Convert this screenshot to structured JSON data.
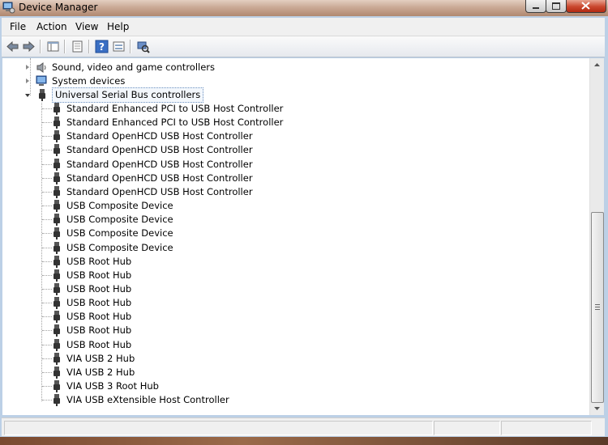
{
  "window": {
    "title": "Device Manager"
  },
  "menu": {
    "items": [
      "File",
      "Action",
      "View",
      "Help"
    ]
  },
  "toolbar": {
    "buttons": [
      "back-arrow-icon",
      "forward-arrow-icon",
      "show-hide-tree-icon",
      "properties-icon",
      "help-icon",
      "view-icon",
      "scan-hardware-icon"
    ]
  },
  "tree": {
    "categories": [
      {
        "label": "Sound, video and game controllers",
        "icon": "speaker-icon",
        "expanded": false
      },
      {
        "label": "System devices",
        "icon": "computer-icon",
        "expanded": false
      },
      {
        "label": "Universal Serial Bus controllers",
        "icon": "usb-plug-icon",
        "expanded": true,
        "selected": true
      }
    ],
    "usb_devices": [
      "Standard Enhanced PCI to USB Host Controller",
      "Standard Enhanced PCI to USB Host Controller",
      "Standard OpenHCD USB Host Controller",
      "Standard OpenHCD USB Host Controller",
      "Standard OpenHCD USB Host Controller",
      "Standard OpenHCD USB Host Controller",
      "Standard OpenHCD USB Host Controller",
      "USB Composite Device",
      "USB Composite Device",
      "USB Composite Device",
      "USB Composite Device",
      "USB Root Hub",
      "USB Root Hub",
      "USB Root Hub",
      "USB Root Hub",
      "USB Root Hub",
      "USB Root Hub",
      "USB Root Hub",
      "VIA USB 2 Hub",
      "VIA USB 2 Hub",
      "VIA USB 3 Root Hub",
      "VIA USB eXtensible Host Controller"
    ]
  },
  "colors": {
    "selection_border": "#6a8fc0",
    "content_bg": "#ffffff"
  }
}
